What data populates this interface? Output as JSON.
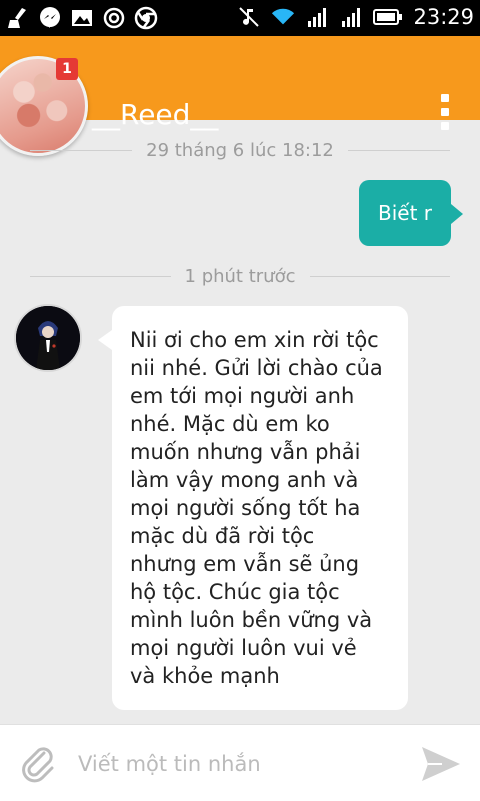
{
  "status_bar": {
    "time": "23:29",
    "left_icons": [
      "broom-icon",
      "messenger-icon",
      "image-icon",
      "at-icon",
      "chrome-icon"
    ],
    "right_icons": [
      "mute-icon",
      "wifi-icon",
      "signal-icon",
      "signal-icon",
      "battery-icon"
    ]
  },
  "header": {
    "name": "__Reed__",
    "badge": "1",
    "accent": "#f7991c"
  },
  "conversation": {
    "time_label_1": "29 tháng 6 lúc 18:12",
    "outgoing_message": "Biết r",
    "time_label_2": "1 phút trước",
    "incoming_message_lines": [
      "Nii ơi cho em xin rời tộc",
      "nii nhé. Gửi lời chào của",
      "em tới mọi người anh",
      "nhé. Mặc dù em ko",
      "muốn nhưng vẫn phải",
      "làm vậy mong anh và",
      "mọi người sống tốt ha",
      "mặc dù đã rời tộc",
      "nhưng em vẫn sẽ ủng",
      "hộ tộc. Chúc gia tộc",
      "mình luôn bền vững và",
      "mọi người luôn vui vẻ",
      "và khỏe mạnh"
    ],
    "outgoing_color": "#1baea6"
  },
  "composer": {
    "placeholder": "Viết một tin nhắn"
  }
}
